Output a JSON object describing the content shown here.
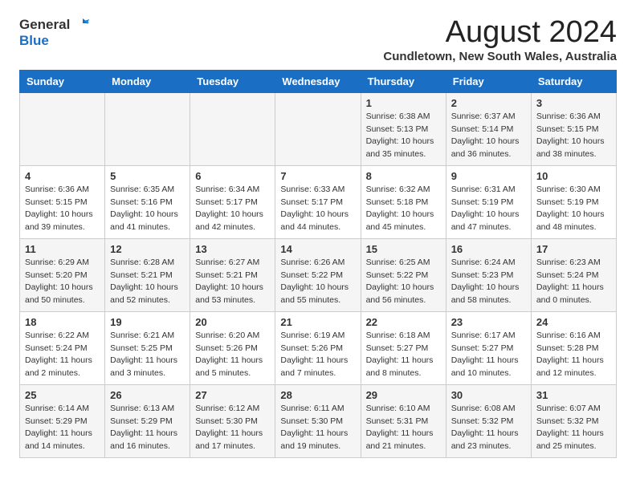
{
  "logo": {
    "general": "General",
    "blue": "Blue"
  },
  "title": "August 2024",
  "subtitle": "Cundletown, New South Wales, Australia",
  "weekdays": [
    "Sunday",
    "Monday",
    "Tuesday",
    "Wednesday",
    "Thursday",
    "Friday",
    "Saturday"
  ],
  "weeks": [
    [
      {
        "day": "",
        "info": ""
      },
      {
        "day": "",
        "info": ""
      },
      {
        "day": "",
        "info": ""
      },
      {
        "day": "",
        "info": ""
      },
      {
        "day": "1",
        "info": "Sunrise: 6:38 AM\nSunset: 5:13 PM\nDaylight: 10 hours\nand 35 minutes."
      },
      {
        "day": "2",
        "info": "Sunrise: 6:37 AM\nSunset: 5:14 PM\nDaylight: 10 hours\nand 36 minutes."
      },
      {
        "day": "3",
        "info": "Sunrise: 6:36 AM\nSunset: 5:15 PM\nDaylight: 10 hours\nand 38 minutes."
      }
    ],
    [
      {
        "day": "4",
        "info": "Sunrise: 6:36 AM\nSunset: 5:15 PM\nDaylight: 10 hours\nand 39 minutes."
      },
      {
        "day": "5",
        "info": "Sunrise: 6:35 AM\nSunset: 5:16 PM\nDaylight: 10 hours\nand 41 minutes."
      },
      {
        "day": "6",
        "info": "Sunrise: 6:34 AM\nSunset: 5:17 PM\nDaylight: 10 hours\nand 42 minutes."
      },
      {
        "day": "7",
        "info": "Sunrise: 6:33 AM\nSunset: 5:17 PM\nDaylight: 10 hours\nand 44 minutes."
      },
      {
        "day": "8",
        "info": "Sunrise: 6:32 AM\nSunset: 5:18 PM\nDaylight: 10 hours\nand 45 minutes."
      },
      {
        "day": "9",
        "info": "Sunrise: 6:31 AM\nSunset: 5:19 PM\nDaylight: 10 hours\nand 47 minutes."
      },
      {
        "day": "10",
        "info": "Sunrise: 6:30 AM\nSunset: 5:19 PM\nDaylight: 10 hours\nand 48 minutes."
      }
    ],
    [
      {
        "day": "11",
        "info": "Sunrise: 6:29 AM\nSunset: 5:20 PM\nDaylight: 10 hours\nand 50 minutes."
      },
      {
        "day": "12",
        "info": "Sunrise: 6:28 AM\nSunset: 5:21 PM\nDaylight: 10 hours\nand 52 minutes."
      },
      {
        "day": "13",
        "info": "Sunrise: 6:27 AM\nSunset: 5:21 PM\nDaylight: 10 hours\nand 53 minutes."
      },
      {
        "day": "14",
        "info": "Sunrise: 6:26 AM\nSunset: 5:22 PM\nDaylight: 10 hours\nand 55 minutes."
      },
      {
        "day": "15",
        "info": "Sunrise: 6:25 AM\nSunset: 5:22 PM\nDaylight: 10 hours\nand 56 minutes."
      },
      {
        "day": "16",
        "info": "Sunrise: 6:24 AM\nSunset: 5:23 PM\nDaylight: 10 hours\nand 58 minutes."
      },
      {
        "day": "17",
        "info": "Sunrise: 6:23 AM\nSunset: 5:24 PM\nDaylight: 11 hours\nand 0 minutes."
      }
    ],
    [
      {
        "day": "18",
        "info": "Sunrise: 6:22 AM\nSunset: 5:24 PM\nDaylight: 11 hours\nand 2 minutes."
      },
      {
        "day": "19",
        "info": "Sunrise: 6:21 AM\nSunset: 5:25 PM\nDaylight: 11 hours\nand 3 minutes."
      },
      {
        "day": "20",
        "info": "Sunrise: 6:20 AM\nSunset: 5:26 PM\nDaylight: 11 hours\nand 5 minutes."
      },
      {
        "day": "21",
        "info": "Sunrise: 6:19 AM\nSunset: 5:26 PM\nDaylight: 11 hours\nand 7 minutes."
      },
      {
        "day": "22",
        "info": "Sunrise: 6:18 AM\nSunset: 5:27 PM\nDaylight: 11 hours\nand 8 minutes."
      },
      {
        "day": "23",
        "info": "Sunrise: 6:17 AM\nSunset: 5:27 PM\nDaylight: 11 hours\nand 10 minutes."
      },
      {
        "day": "24",
        "info": "Sunrise: 6:16 AM\nSunset: 5:28 PM\nDaylight: 11 hours\nand 12 minutes."
      }
    ],
    [
      {
        "day": "25",
        "info": "Sunrise: 6:14 AM\nSunset: 5:29 PM\nDaylight: 11 hours\nand 14 minutes."
      },
      {
        "day": "26",
        "info": "Sunrise: 6:13 AM\nSunset: 5:29 PM\nDaylight: 11 hours\nand 16 minutes."
      },
      {
        "day": "27",
        "info": "Sunrise: 6:12 AM\nSunset: 5:30 PM\nDaylight: 11 hours\nand 17 minutes."
      },
      {
        "day": "28",
        "info": "Sunrise: 6:11 AM\nSunset: 5:30 PM\nDaylight: 11 hours\nand 19 minutes."
      },
      {
        "day": "29",
        "info": "Sunrise: 6:10 AM\nSunset: 5:31 PM\nDaylight: 11 hours\nand 21 minutes."
      },
      {
        "day": "30",
        "info": "Sunrise: 6:08 AM\nSunset: 5:32 PM\nDaylight: 11 hours\nand 23 minutes."
      },
      {
        "day": "31",
        "info": "Sunrise: 6:07 AM\nSunset: 5:32 PM\nDaylight: 11 hours\nand 25 minutes."
      }
    ]
  ]
}
